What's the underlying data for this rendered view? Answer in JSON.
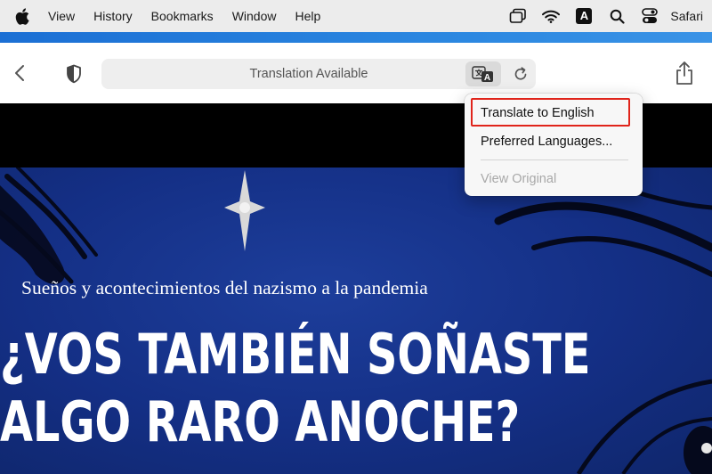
{
  "menubar": {
    "items": [
      "View",
      "History",
      "Bookmarks",
      "Window",
      "Help"
    ],
    "tray": {
      "keyboard_input_letter": "A",
      "app_name": "Safari"
    }
  },
  "toolbar": {
    "address_text": "Translation Available",
    "translate_icon_letter": "A"
  },
  "popup": {
    "items": [
      {
        "label": "Translate to English",
        "enabled": true,
        "highlighted": true
      },
      {
        "label": "Preferred Languages...",
        "enabled": true,
        "highlighted": false
      },
      {
        "label": "View Original",
        "enabled": false,
        "highlighted": false
      }
    ]
  },
  "page": {
    "subtitle": "Sueños y acontecimientos del nazismo a la pandemia",
    "headline_line1": "¿VOS TAMBIÉN SOÑASTE",
    "headline_line2": "ALGO RARO ANOCHE?"
  },
  "colors": {
    "accent_strip": "#1b6fd4",
    "hero_blue": "#142f85",
    "highlight_red": "#e0241b"
  },
  "icons": [
    "apple-icon",
    "stage-manager-icon",
    "wifi-icon",
    "keyboard-input-icon",
    "search-icon",
    "control-center-icon",
    "back-icon",
    "privacy-shield-icon",
    "translate-icon",
    "reload-icon",
    "share-icon"
  ]
}
